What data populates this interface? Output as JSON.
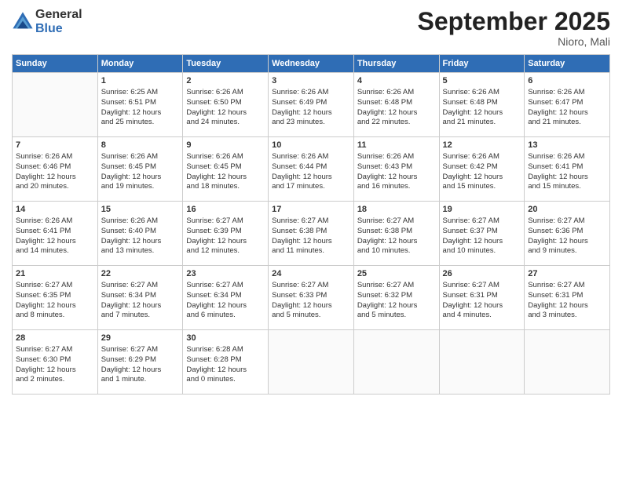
{
  "header": {
    "logo_line1": "General",
    "logo_line2": "Blue",
    "month": "September 2025",
    "location": "Nioro, Mali"
  },
  "days_of_week": [
    "Sunday",
    "Monday",
    "Tuesday",
    "Wednesday",
    "Thursday",
    "Friday",
    "Saturday"
  ],
  "weeks": [
    [
      {
        "day": "",
        "info": ""
      },
      {
        "day": "1",
        "info": "Sunrise: 6:25 AM\nSunset: 6:51 PM\nDaylight: 12 hours\nand 25 minutes."
      },
      {
        "day": "2",
        "info": "Sunrise: 6:26 AM\nSunset: 6:50 PM\nDaylight: 12 hours\nand 24 minutes."
      },
      {
        "day": "3",
        "info": "Sunrise: 6:26 AM\nSunset: 6:49 PM\nDaylight: 12 hours\nand 23 minutes."
      },
      {
        "day": "4",
        "info": "Sunrise: 6:26 AM\nSunset: 6:48 PM\nDaylight: 12 hours\nand 22 minutes."
      },
      {
        "day": "5",
        "info": "Sunrise: 6:26 AM\nSunset: 6:48 PM\nDaylight: 12 hours\nand 21 minutes."
      },
      {
        "day": "6",
        "info": "Sunrise: 6:26 AM\nSunset: 6:47 PM\nDaylight: 12 hours\nand 21 minutes."
      }
    ],
    [
      {
        "day": "7",
        "info": "Sunrise: 6:26 AM\nSunset: 6:46 PM\nDaylight: 12 hours\nand 20 minutes."
      },
      {
        "day": "8",
        "info": "Sunrise: 6:26 AM\nSunset: 6:45 PM\nDaylight: 12 hours\nand 19 minutes."
      },
      {
        "day": "9",
        "info": "Sunrise: 6:26 AM\nSunset: 6:45 PM\nDaylight: 12 hours\nand 18 minutes."
      },
      {
        "day": "10",
        "info": "Sunrise: 6:26 AM\nSunset: 6:44 PM\nDaylight: 12 hours\nand 17 minutes."
      },
      {
        "day": "11",
        "info": "Sunrise: 6:26 AM\nSunset: 6:43 PM\nDaylight: 12 hours\nand 16 minutes."
      },
      {
        "day": "12",
        "info": "Sunrise: 6:26 AM\nSunset: 6:42 PM\nDaylight: 12 hours\nand 15 minutes."
      },
      {
        "day": "13",
        "info": "Sunrise: 6:26 AM\nSunset: 6:41 PM\nDaylight: 12 hours\nand 15 minutes."
      }
    ],
    [
      {
        "day": "14",
        "info": "Sunrise: 6:26 AM\nSunset: 6:41 PM\nDaylight: 12 hours\nand 14 minutes."
      },
      {
        "day": "15",
        "info": "Sunrise: 6:26 AM\nSunset: 6:40 PM\nDaylight: 12 hours\nand 13 minutes."
      },
      {
        "day": "16",
        "info": "Sunrise: 6:27 AM\nSunset: 6:39 PM\nDaylight: 12 hours\nand 12 minutes."
      },
      {
        "day": "17",
        "info": "Sunrise: 6:27 AM\nSunset: 6:38 PM\nDaylight: 12 hours\nand 11 minutes."
      },
      {
        "day": "18",
        "info": "Sunrise: 6:27 AM\nSunset: 6:38 PM\nDaylight: 12 hours\nand 10 minutes."
      },
      {
        "day": "19",
        "info": "Sunrise: 6:27 AM\nSunset: 6:37 PM\nDaylight: 12 hours\nand 10 minutes."
      },
      {
        "day": "20",
        "info": "Sunrise: 6:27 AM\nSunset: 6:36 PM\nDaylight: 12 hours\nand 9 minutes."
      }
    ],
    [
      {
        "day": "21",
        "info": "Sunrise: 6:27 AM\nSunset: 6:35 PM\nDaylight: 12 hours\nand 8 minutes."
      },
      {
        "day": "22",
        "info": "Sunrise: 6:27 AM\nSunset: 6:34 PM\nDaylight: 12 hours\nand 7 minutes."
      },
      {
        "day": "23",
        "info": "Sunrise: 6:27 AM\nSunset: 6:34 PM\nDaylight: 12 hours\nand 6 minutes."
      },
      {
        "day": "24",
        "info": "Sunrise: 6:27 AM\nSunset: 6:33 PM\nDaylight: 12 hours\nand 5 minutes."
      },
      {
        "day": "25",
        "info": "Sunrise: 6:27 AM\nSunset: 6:32 PM\nDaylight: 12 hours\nand 5 minutes."
      },
      {
        "day": "26",
        "info": "Sunrise: 6:27 AM\nSunset: 6:31 PM\nDaylight: 12 hours\nand 4 minutes."
      },
      {
        "day": "27",
        "info": "Sunrise: 6:27 AM\nSunset: 6:31 PM\nDaylight: 12 hours\nand 3 minutes."
      }
    ],
    [
      {
        "day": "28",
        "info": "Sunrise: 6:27 AM\nSunset: 6:30 PM\nDaylight: 12 hours\nand 2 minutes."
      },
      {
        "day": "29",
        "info": "Sunrise: 6:27 AM\nSunset: 6:29 PM\nDaylight: 12 hours\nand 1 minute."
      },
      {
        "day": "30",
        "info": "Sunrise: 6:28 AM\nSunset: 6:28 PM\nDaylight: 12 hours\nand 0 minutes."
      },
      {
        "day": "",
        "info": ""
      },
      {
        "day": "",
        "info": ""
      },
      {
        "day": "",
        "info": ""
      },
      {
        "day": "",
        "info": ""
      }
    ]
  ]
}
